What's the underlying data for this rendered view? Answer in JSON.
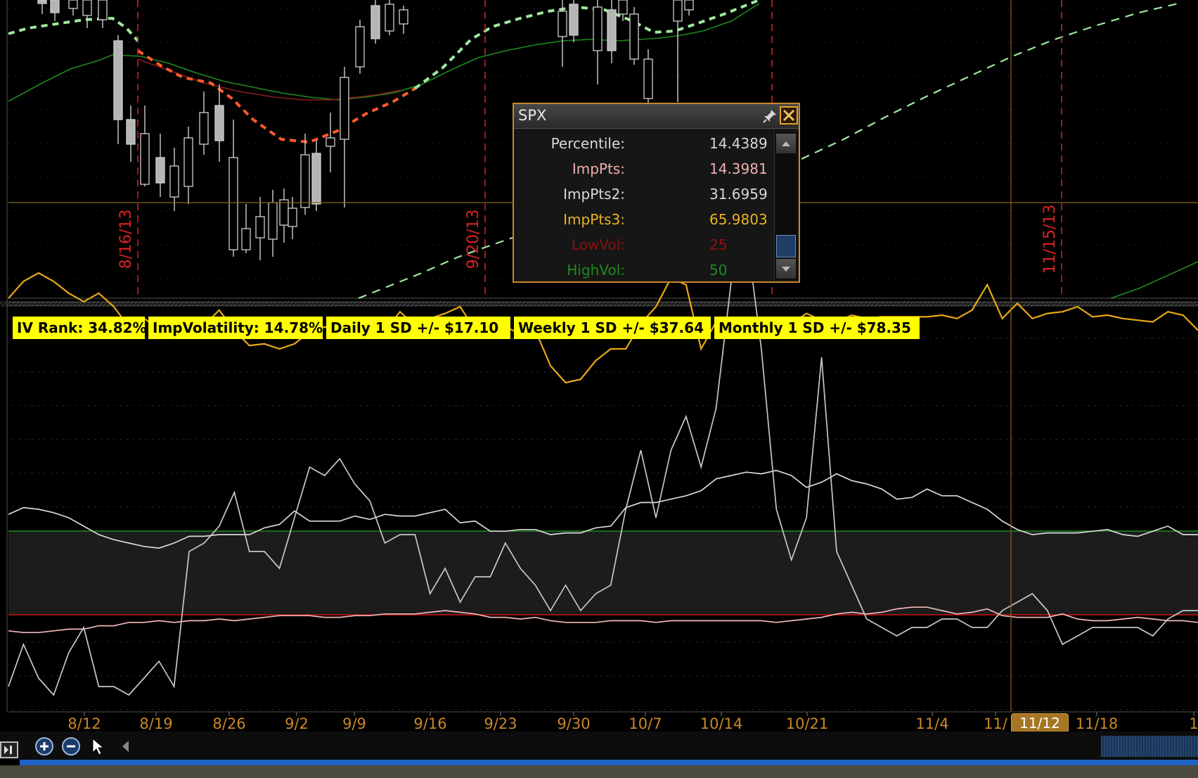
{
  "chart_data": [
    {
      "type": "candlestick",
      "symbol": "SPX",
      "expiration_markers": [
        "8/16/13",
        "9/20/13",
        "11/15/13"
      ]
    },
    {
      "type": "line",
      "series": [
        {
          "name": "ImpPts3",
          "color": "#e6a817",
          "values": [
            24.0,
            25.0,
            25.5,
            25.0,
            24.3,
            23.8,
            24.3,
            23.5,
            22.3,
            22.8,
            22.2,
            22.4,
            21.7,
            22.4,
            23.3,
            22.1,
            21.2,
            21.3,
            21.0,
            21.3,
            22.0,
            22.3,
            22.1,
            21.9,
            21.9,
            22.0,
            23.2,
            22.4,
            22.8,
            23.1,
            23.5,
            22.1,
            22.4,
            22.3,
            21.9,
            22.1,
            20.0,
            19.0,
            19.2,
            20.3,
            21.0,
            21.0,
            22.5,
            23.5,
            25.2,
            24.8,
            21.0,
            22.6,
            22.2,
            22.5,
            22.4,
            22.7,
            22.5,
            23.1,
            22.7,
            22.6,
            23.0,
            22.8,
            22.9,
            22.9,
            22.9,
            22.9,
            23.0,
            22.8,
            23.3,
            24.8,
            22.8,
            23.7,
            22.8,
            23.1,
            23.2,
            23.5,
            22.9,
            23.0,
            22.8,
            22.7,
            22.6,
            23.2,
            23.0,
            22.1
          ]
        },
        {
          "name": "ImpPts2",
          "color": "#d8d8d8",
          "values": [
            11.2,
            11.6,
            11.5,
            11.3,
            11.0,
            10.5,
            10.0,
            9.7,
            9.5,
            9.3,
            9.2,
            9.5,
            9.9,
            9.9,
            10.0,
            10.0,
            10.0,
            10.4,
            10.6,
            11.4,
            10.8,
            10.8,
            10.8,
            11.1,
            10.9,
            11.2,
            11.1,
            11.1,
            11.3,
            11.5,
            10.7,
            10.8,
            10.2,
            10.2,
            10.3,
            10.3,
            10.0,
            10.1,
            10.1,
            10.4,
            10.5,
            11.6,
            11.9,
            11.9,
            12.1,
            12.3,
            12.6,
            13.3,
            13.5,
            13.7,
            13.6,
            13.8,
            13.5,
            12.8,
            13.1,
            13.6,
            13.2,
            13.0,
            12.7,
            12.1,
            12.2,
            12.7,
            12.3,
            12.3,
            11.9,
            11.5,
            10.8,
            10.3,
            10.0,
            10.1,
            10.1,
            10.1,
            10.2,
            10.3,
            10.0,
            9.9,
            10.2,
            10.5,
            10.0,
            10.0
          ]
        },
        {
          "name": "ImpPts",
          "color": "#f0b8b8",
          "values": [
            4.3,
            4.2,
            4.2,
            4.3,
            4.4,
            4.4,
            4.6,
            4.6,
            4.8,
            4.8,
            4.9,
            4.8,
            4.9,
            4.9,
            5.0,
            4.9,
            5.0,
            5.1,
            5.2,
            5.2,
            5.2,
            5.1,
            5.1,
            5.2,
            5.2,
            5.3,
            5.3,
            5.3,
            5.4,
            5.5,
            5.4,
            5.3,
            5.1,
            5.1,
            5.0,
            5.1,
            4.9,
            4.8,
            4.8,
            4.8,
            4.9,
            4.9,
            4.9,
            4.8,
            4.9,
            4.9,
            4.9,
            4.9,
            4.9,
            4.9,
            4.9,
            4.8,
            4.9,
            5.0,
            5.1,
            5.3,
            5.4,
            5.3,
            5.4,
            5.6,
            5.7,
            5.7,
            5.5,
            5.3,
            5.4,
            5.6,
            5.2,
            5.1,
            5.1,
            5.1,
            5.3,
            5.0,
            4.9,
            4.9,
            5.0,
            5.1,
            5.0,
            4.9,
            4.9,
            4.8
          ]
        },
        {
          "name": "Percentile",
          "color": "#c8c8c8",
          "values": [
            1.0,
            3.5,
            1.5,
            0.5,
            3.0,
            4.5,
            1.0,
            1.0,
            0.5,
            1.5,
            2.5,
            1.0,
            9.0,
            9.5,
            10.5,
            12.5,
            9.0,
            9.0,
            8.0,
            11.0,
            14.0,
            13.5,
            14.5,
            13.0,
            12.0,
            9.5,
            10.0,
            10.0,
            6.5,
            8.0,
            6.0,
            7.5,
            7.5,
            9.5,
            8.0,
            7.0,
            5.5,
            7.0,
            5.5,
            6.5,
            7.0,
            11.5,
            15.0,
            11.0,
            15.0,
            17.0,
            14.0,
            17.5,
            25.0,
            28.0,
            21.0,
            11.5,
            8.5,
            11.0,
            20.5,
            9.0,
            7.0,
            5.0,
            4.5,
            4.0,
            4.5,
            4.5,
            5.0,
            5.0,
            4.5,
            4.5,
            5.5,
            6.0,
            6.5,
            5.5,
            3.5,
            4.0,
            4.5,
            4.5,
            4.5,
            4.5,
            4.0,
            5.0,
            5.5,
            5.5
          ]
        }
      ],
      "thresholds": [
        {
          "name": "LowVol",
          "value": 25,
          "color": "#cc1111"
        },
        {
          "name": "HighVol",
          "value": 50,
          "color": "#1e8c1e"
        }
      ],
      "x_ticks": [
        "8/12",
        "8/19",
        "8/26",
        "9/2",
        "9/9",
        "9/16",
        "9/23",
        "9/30",
        "10/7",
        "10/14",
        "10/21",
        "11/4",
        "11/",
        "11/18",
        "1"
      ],
      "current_date": "11/12"
    }
  ],
  "study_badges": {
    "iv_rank": "IV Rank: 34.82%",
    "imp_volatility": "ImpVolatility: 14.78%",
    "daily_sd": "Daily 1 SD +/- $17.10",
    "weekly_sd": "Weekly 1 SD +/- $37.64",
    "monthly_sd": "Monthly 1 SD +/- $78.35"
  },
  "popup": {
    "title": "SPX",
    "rows": [
      {
        "label": "Percentile:",
        "value": "14.4389",
        "color": "#d8d8d8"
      },
      {
        "label": "ImpPts:",
        "value": "14.3981",
        "color": "#f0b0b0"
      },
      {
        "label": "ImpPts2:",
        "value": "31.6959",
        "color": "#d8d8d8"
      },
      {
        "label": "ImpPts3:",
        "value": "65.9803",
        "color": "#e6b420"
      },
      {
        "label": "LowVol:",
        "value": "25",
        "color": "#8a1212"
      },
      {
        "label": "HighVol:",
        "value": "50",
        "color": "#1f8a1f"
      }
    ]
  },
  "colors": {
    "accent": "#c8882a",
    "badge_bg": "#ffff00",
    "expiration_line": "#dd2222",
    "background": "#000000"
  },
  "toolbar": {
    "icons": [
      "panel-toggle-icon",
      "zoom-in-icon",
      "zoom-out-icon",
      "pointer-icon",
      "scroll-left-icon"
    ]
  }
}
